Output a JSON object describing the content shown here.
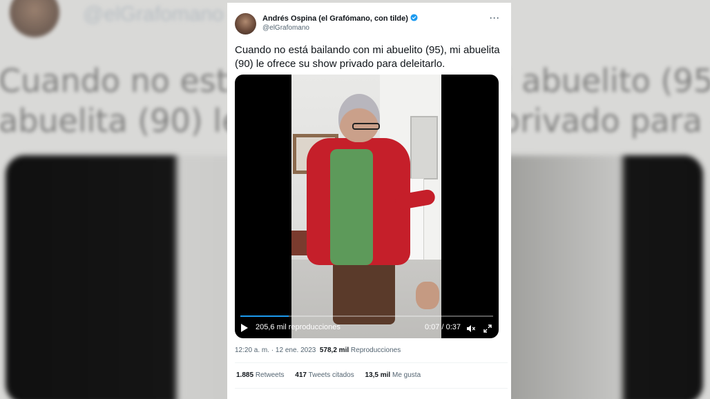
{
  "background": {
    "handle": "@elGrafomano",
    "text": "Cuando no está bailando con mi abuelito (95), mi abuelita (90) le ofrece su show privado para deleitarlo."
  },
  "tweet": {
    "author_name": "Andrés Ospina (el Grafómano, con tilde)",
    "handle": "@elGrafomano",
    "more_icon": "more-dots-icon",
    "text": "Cuando no está bailando con mi abuelito (95), mi abuelita (90) le ofrece su show privado para deleitarlo.",
    "verified_color": "#1d9bf0"
  },
  "video": {
    "views_label": "205,6 mil reproducciones",
    "current_time": "0:07",
    "duration": "0:37",
    "time_label": "0:07 / 0:37",
    "progress_fraction": 0.19,
    "progress_color": "#1d9bf0"
  },
  "meta": {
    "time": "12:20 a. m.",
    "separator": " · ",
    "date": "12 ene. 2023",
    "views_count": "578,2 mil",
    "views_label": "Reproducciones"
  },
  "stats": {
    "retweets_count": "1.885",
    "retweets_label": "Retweets",
    "quotes_count": "417",
    "quotes_label": "Tweets citados",
    "likes_count": "13,5 mil",
    "likes_label": "Me gusta"
  }
}
